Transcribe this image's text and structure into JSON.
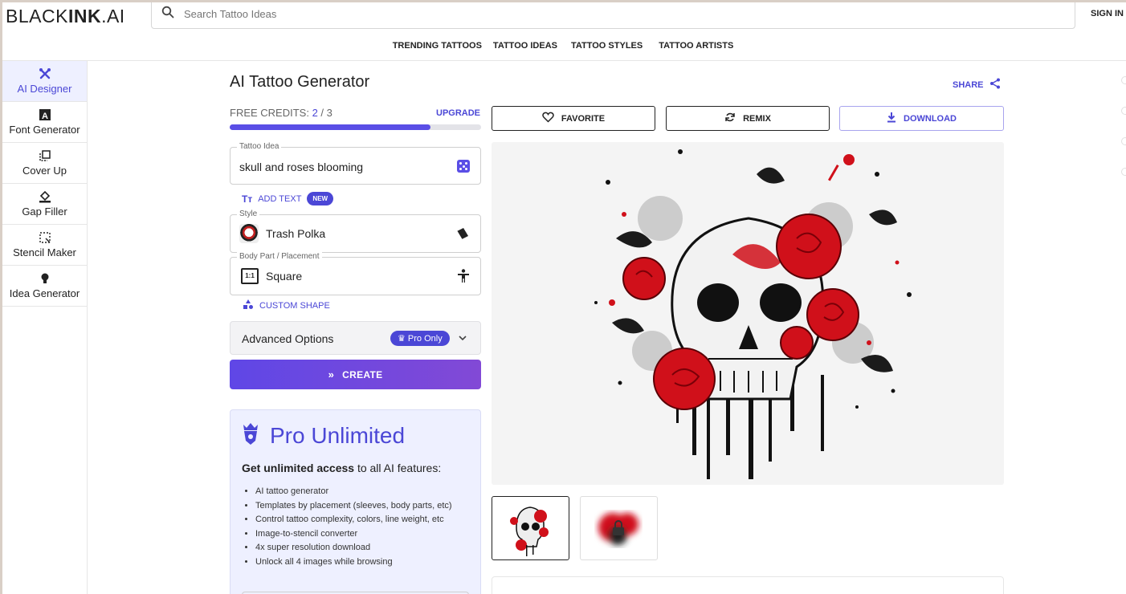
{
  "brand": {
    "logo_light": "BLACK",
    "logo_bold": "INK",
    "logo_suffix": ".AI"
  },
  "search": {
    "placeholder": "Search Tattoo Ideas",
    "icon": "search-icon"
  },
  "header": {
    "sign_in": "SIGN IN"
  },
  "nav": [
    "TRENDING TATTOOS",
    "TATTOO IDEAS",
    "TATTOO STYLES",
    "TATTOO ARTISTS"
  ],
  "sidebar": {
    "items": [
      {
        "label": "AI Designer",
        "icon": "ai-designer-icon",
        "active": true
      },
      {
        "label": "Font Generator",
        "icon": "font-icon"
      },
      {
        "label": "Cover Up",
        "icon": "cover-up-icon"
      },
      {
        "label": "Gap Filler",
        "icon": "paint-bucket-icon"
      },
      {
        "label": "Stencil Maker",
        "icon": "stencil-icon"
      },
      {
        "label": "Idea Generator",
        "icon": "lightbulb-icon"
      }
    ]
  },
  "generator": {
    "title": "AI Tattoo Generator",
    "credits_label": "FREE CREDITS: ",
    "credits_used": "2",
    "credits_sep": " / ",
    "credits_total": "3",
    "credits_fraction": 0.8,
    "upgrade": "UPGRADE",
    "tattoo_idea": {
      "label": "Tattoo Idea",
      "value": "skull and roses blooming"
    },
    "add_text": {
      "label": "ADD TEXT",
      "badge": "NEW"
    },
    "style": {
      "label": "Style",
      "value": "Trash Polka"
    },
    "placement": {
      "label": "Body Part / Placement",
      "value": "Square",
      "ratio": "1:1"
    },
    "custom_shape": "CUSTOM SHAPE",
    "advanced": {
      "label": "Advanced Options",
      "badge": "Pro Only"
    },
    "create": "CREATE"
  },
  "pro": {
    "title": "Pro Unlimited",
    "subtitle_bold": "Get unlimited access",
    "subtitle_rest": " to all AI features:",
    "features": [
      "AI tattoo generator",
      "Templates by placement (sleeves, body parts, etc)",
      "Control tattoo complexity, colors, line weight, etc",
      "Image-to-stencil converter",
      "4x super resolution download",
      "Unlock all 4 images while browsing"
    ]
  },
  "result": {
    "share": "SHARE",
    "favorite": "FAVORITE",
    "remix": "REMIX",
    "download": "DOWNLOAD"
  },
  "colors": {
    "accent": "#4b47d6",
    "brand_gradient_start": "#5f47e6",
    "brand_gradient_end": "#8249d6",
    "rose": "#d0101a"
  }
}
